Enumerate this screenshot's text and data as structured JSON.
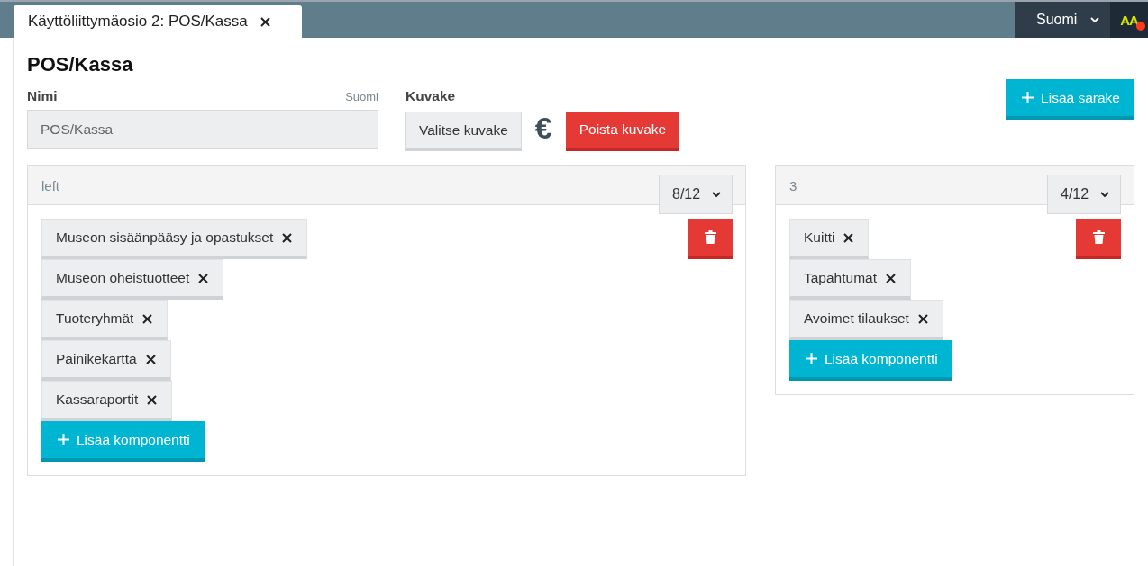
{
  "tab": {
    "title": "Käyttöliittymäosio 2: POS/Kassa"
  },
  "language_menu": {
    "label": "Suomi"
  },
  "user_avatar": {
    "initials": "AA",
    "has_notification": true
  },
  "page_title": "POS/Kassa",
  "name_field": {
    "label": "Nimi",
    "language": "Suomi",
    "value": "POS/Kassa"
  },
  "icon_field": {
    "label": "Kuvake",
    "choose_button": "Valitse kuvake",
    "symbol": "€",
    "remove_button": "Poista kuvake"
  },
  "add_column_button": "Lisää sarake",
  "columns": [
    {
      "name": "left",
      "width": "8/12",
      "components": [
        "Museon sisäänpääsy ja opastukset",
        "Museon oheistuotteet",
        "Tuoteryhmät",
        "Painikekartta",
        "Kassaraportit"
      ],
      "add_button": "Lisää komponentti"
    },
    {
      "name": "3",
      "width": "4/12",
      "components": [
        "Kuitti",
        "Tapahtumat",
        "Avoimet tilaukset"
      ],
      "add_button": "Lisää komponentti"
    }
  ]
}
